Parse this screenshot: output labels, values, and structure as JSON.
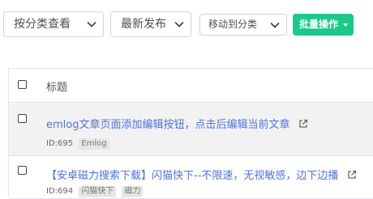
{
  "toolbar": {
    "category_filter": "按分类查看",
    "sort_order": "最新发布",
    "move_to_category": "移动到分类",
    "batch_button": "批量操作"
  },
  "table": {
    "header_title": "标题",
    "rows": [
      {
        "title": "emlog文章页面添加编辑按钮，点击后编辑当前文章",
        "id_text": "ID:695",
        "tags": [
          "Emlog"
        ]
      },
      {
        "title": "【安卓磁力搜索下载】闪猫快下--不限速，无视敏感，边下边播",
        "id_text": "ID:694",
        "tags": [
          "闪猫快下",
          "磁力"
        ]
      }
    ]
  },
  "colors": {
    "accent_link": "#4e73df",
    "batch_button_bg": "#1cc88a",
    "row_highlight": "#f2f2f2"
  }
}
